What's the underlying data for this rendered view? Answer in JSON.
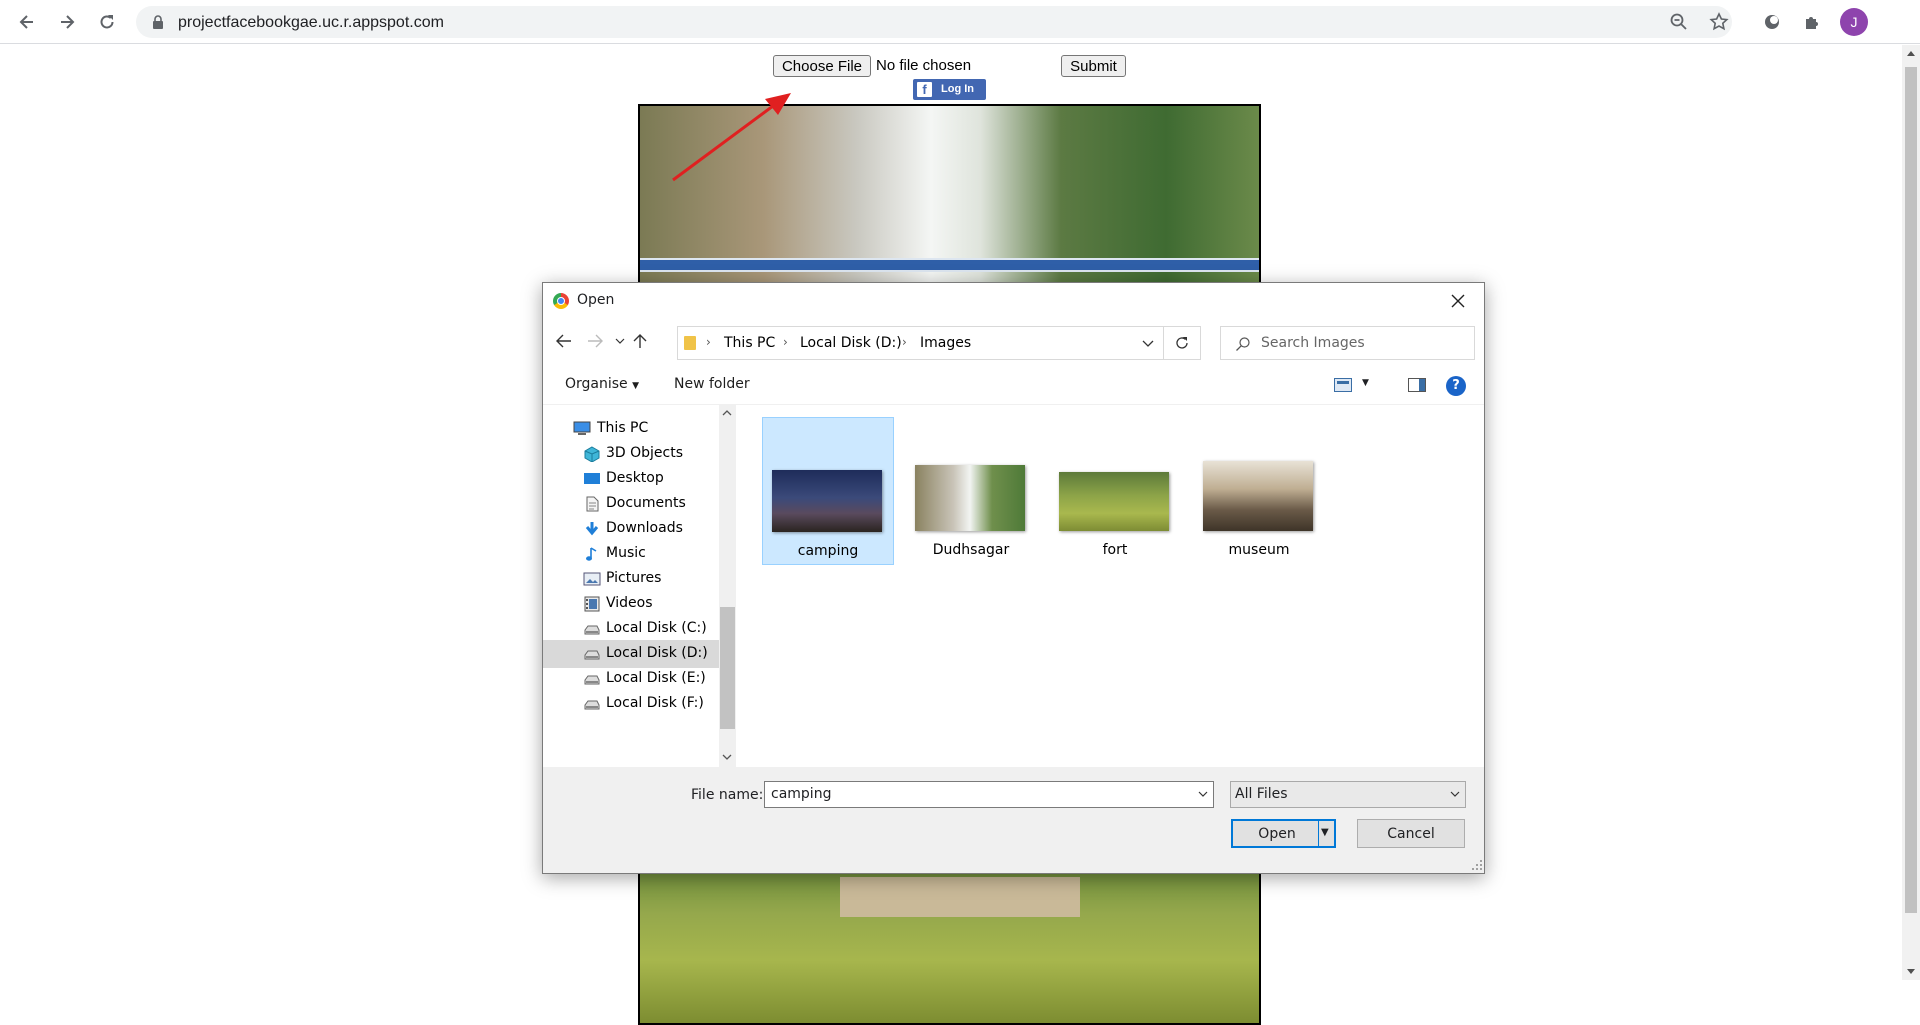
{
  "browser": {
    "url": "projectfacebookgae.uc.r.appspot.com",
    "avatar_initial": "J"
  },
  "page": {
    "choose_file_label": "Choose File",
    "no_file_label": "No file chosen",
    "submit_label": "Submit",
    "fb_login_label": "Log In",
    "annotation_color": "#e02020"
  },
  "dialog": {
    "title": "Open",
    "breadcrumb": [
      "This PC",
      "Local Disk (D:)",
      "Images"
    ],
    "search_placeholder": "Search Images",
    "organise_label": "Organise",
    "new_folder_label": "New folder",
    "help_label": "?",
    "nav_items": [
      {
        "label": "This PC",
        "icon": "computer-icon"
      },
      {
        "label": "3D Objects",
        "icon": "cube-icon"
      },
      {
        "label": "Desktop",
        "icon": "desktop-icon"
      },
      {
        "label": "Documents",
        "icon": "document-icon"
      },
      {
        "label": "Downloads",
        "icon": "download-icon"
      },
      {
        "label": "Music",
        "icon": "music-icon"
      },
      {
        "label": "Pictures",
        "icon": "pictures-icon"
      },
      {
        "label": "Videos",
        "icon": "video-icon"
      },
      {
        "label": "Local Disk (C:)",
        "icon": "drive-icon"
      },
      {
        "label": "Local Disk (D:)",
        "icon": "drive-icon",
        "selected": true
      },
      {
        "label": "Local Disk (E:)",
        "icon": "drive-icon"
      },
      {
        "label": "Local Disk (F:)",
        "icon": "drive-icon"
      }
    ],
    "files": [
      {
        "name": "camping",
        "selected": true
      },
      {
        "name": "Dudhsagar"
      },
      {
        "name": "fort"
      },
      {
        "name": "museum"
      }
    ],
    "file_name_label": "File name:",
    "file_name_value": "camping",
    "file_type_value": "All Files",
    "open_label": "Open",
    "cancel_label": "Cancel",
    "selection_color": "#cce8ff",
    "accent_color": "#0078d7"
  }
}
